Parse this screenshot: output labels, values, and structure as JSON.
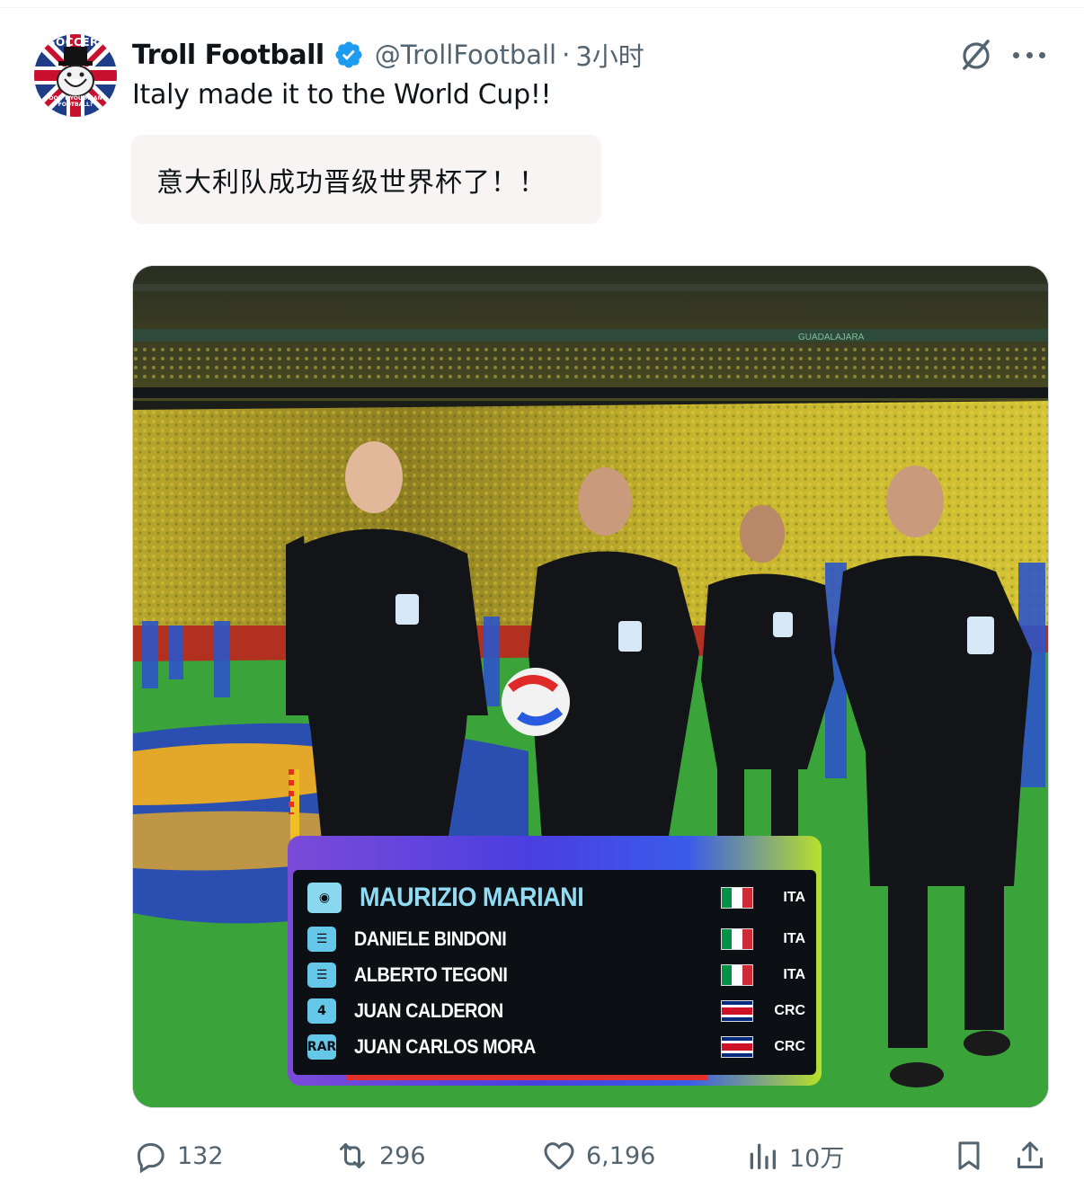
{
  "tweet": {
    "display_name": "Troll Football",
    "handle": "@TrollFootball",
    "separator": "·",
    "time": "3小时",
    "text": "Italy made it to the World Cup!!",
    "translation": "意大利队成功晋级世界杯了！！",
    "avatar": {
      "top_text": "SOCCER:",
      "bottom_text": "DON'T YOU MEAN FOOTBALL?"
    }
  },
  "image": {
    "banner_text": "GUADALAJARA",
    "officials": [
      {
        "role": "referee-whistle",
        "badge": "",
        "name": "MAURIZIO MARIANI",
        "country": "ITA",
        "flag": "ita"
      },
      {
        "role": "assistant",
        "badge": "",
        "name": "DANIELE BINDONI",
        "country": "ITA",
        "flag": "ita"
      },
      {
        "role": "assistant",
        "badge": "",
        "name": "ALBERTO TEGONI",
        "country": "ITA",
        "flag": "ita"
      },
      {
        "role": "fourth",
        "badge": "4",
        "name": "JUAN CALDERON",
        "country": "CRC",
        "flag": "crc"
      },
      {
        "role": "rar",
        "badge": "RAR",
        "name": "JUAN CARLOS MORA",
        "country": "CRC",
        "flag": "crc"
      }
    ]
  },
  "actions": {
    "replies": "132",
    "reposts": "296",
    "likes": "6,196",
    "views": "10万"
  },
  "colors": {
    "text_primary": "#0f1419",
    "text_secondary": "#536471",
    "verified": "#1d9bf0",
    "translation_bg": "#f7f4f3"
  }
}
